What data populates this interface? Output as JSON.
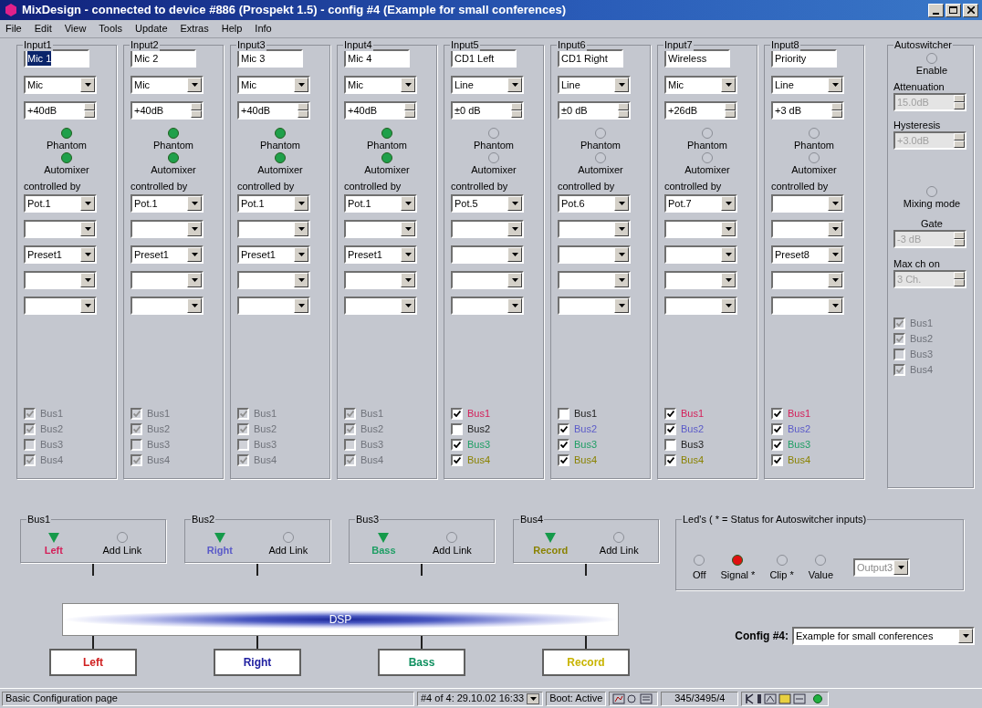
{
  "window": {
    "title": "MixDesign - connected to device #886 (Prospekt 1.5)  -  config #4 (Example for small conferences)"
  },
  "menu": [
    "File",
    "Edit",
    "View",
    "Tools",
    "Update",
    "Extras",
    "Help",
    "Info"
  ],
  "inputs": [
    {
      "title": "Input1",
      "name": "Mic 1",
      "name_selected": true,
      "type": "Mic",
      "gain": "+40dB",
      "phantom_label": "Phantom",
      "phantom": true,
      "automixer_label": "Automixer",
      "automixer": true,
      "controlled_by": "controlled by",
      "controls": [
        {
          "kind": "set",
          "value": "Pot.1"
        },
        {
          "kind": "blank"
        },
        {
          "kind": "set",
          "value": "Preset1"
        },
        {
          "kind": "blank"
        },
        {
          "kind": "blank"
        }
      ],
      "buses_disabled": true,
      "buses": [
        {
          "label": "Bus1",
          "checked": true
        },
        {
          "label": "Bus2",
          "checked": true
        },
        {
          "label": "Bus3",
          "checked": false
        },
        {
          "label": "Bus4",
          "checked": true
        }
      ]
    },
    {
      "title": "Input2",
      "name": "Mic 2",
      "name_selected": false,
      "type": "Mic",
      "gain": "+40dB",
      "phantom_label": "Phantom",
      "phantom": true,
      "automixer_label": "Automixer",
      "automixer": true,
      "controlled_by": "controlled by",
      "controls": [
        {
          "kind": "set",
          "value": "Pot.1"
        },
        {
          "kind": "blank"
        },
        {
          "kind": "set",
          "value": "Preset1"
        },
        {
          "kind": "blank"
        },
        {
          "kind": "blank"
        }
      ],
      "buses_disabled": true,
      "buses": [
        {
          "label": "Bus1",
          "checked": true
        },
        {
          "label": "Bus2",
          "checked": true
        },
        {
          "label": "Bus3",
          "checked": false
        },
        {
          "label": "Bus4",
          "checked": true
        }
      ]
    },
    {
      "title": "Input3",
      "name": "Mic 3",
      "name_selected": false,
      "type": "Mic",
      "gain": "+40dB",
      "phantom_label": "Phantom",
      "phantom": true,
      "automixer_label": "Automixer",
      "automixer": true,
      "controlled_by": "controlled by",
      "controls": [
        {
          "kind": "set",
          "value": "Pot.1"
        },
        {
          "kind": "blank"
        },
        {
          "kind": "set",
          "value": "Preset1"
        },
        {
          "kind": "blank"
        },
        {
          "kind": "blank"
        }
      ],
      "buses_disabled": true,
      "buses": [
        {
          "label": "Bus1",
          "checked": true
        },
        {
          "label": "Bus2",
          "checked": true
        },
        {
          "label": "Bus3",
          "checked": false
        },
        {
          "label": "Bus4",
          "checked": true
        }
      ]
    },
    {
      "title": "Input4",
      "name": "Mic 4",
      "name_selected": false,
      "type": "Mic",
      "gain": "+40dB",
      "phantom_label": "Phantom",
      "phantom": true,
      "automixer_label": "Automixer",
      "automixer": true,
      "controlled_by": "controlled by",
      "controls": [
        {
          "kind": "set",
          "value": "Pot.1"
        },
        {
          "kind": "blank"
        },
        {
          "kind": "set",
          "value": "Preset1"
        },
        {
          "kind": "blank"
        },
        {
          "kind": "blank"
        }
      ],
      "buses_disabled": true,
      "buses": [
        {
          "label": "Bus1",
          "checked": true
        },
        {
          "label": "Bus2",
          "checked": true
        },
        {
          "label": "Bus3",
          "checked": false
        },
        {
          "label": "Bus4",
          "checked": true
        }
      ]
    },
    {
      "title": "Input5",
      "name": "CD1 Left",
      "name_selected": false,
      "type": "Line",
      "gain": "±0 dB",
      "phantom_label": "Phantom",
      "phantom": false,
      "automixer_label": "Automixer",
      "automixer": false,
      "controlled_by": "controlled by",
      "controls": [
        {
          "kind": "set",
          "value": "Pot.5"
        },
        {
          "kind": "blank"
        },
        {
          "kind": "blank"
        },
        {
          "kind": "blank"
        },
        {
          "kind": "blank"
        }
      ],
      "buses_disabled": false,
      "buses": [
        {
          "label": "Bus1",
          "checked": true
        },
        {
          "label": "Bus2",
          "checked": false
        },
        {
          "label": "Bus3",
          "checked": true
        },
        {
          "label": "Bus4",
          "checked": true
        }
      ]
    },
    {
      "title": "Input6",
      "name": "CD1 Right",
      "name_selected": false,
      "type": "Line",
      "gain": "±0 dB",
      "phantom_label": "Phantom",
      "phantom": false,
      "automixer_label": "Automixer",
      "automixer": false,
      "controlled_by": "controlled by",
      "controls": [
        {
          "kind": "set",
          "value": "Pot.6"
        },
        {
          "kind": "blank"
        },
        {
          "kind": "blank"
        },
        {
          "kind": "blank"
        },
        {
          "kind": "blank"
        }
      ],
      "buses_disabled": false,
      "buses": [
        {
          "label": "Bus1",
          "checked": false
        },
        {
          "label": "Bus2",
          "checked": true
        },
        {
          "label": "Bus3",
          "checked": true
        },
        {
          "label": "Bus4",
          "checked": true
        }
      ]
    },
    {
      "title": "Input7",
      "name": "Wireless",
      "name_selected": false,
      "type": "Mic",
      "gain": "+26dB",
      "phantom_label": "Phantom",
      "phantom": false,
      "automixer_label": "Automixer",
      "automixer": false,
      "controlled_by": "controlled by",
      "controls": [
        {
          "kind": "set",
          "value": "Pot.7"
        },
        {
          "kind": "blank"
        },
        {
          "kind": "blank"
        },
        {
          "kind": "blank"
        },
        {
          "kind": "blank"
        }
      ],
      "buses_disabled": false,
      "buses": [
        {
          "label": "Bus1",
          "checked": true
        },
        {
          "label": "Bus2",
          "checked": true
        },
        {
          "label": "Bus3",
          "checked": false
        },
        {
          "label": "Bus4",
          "checked": true
        }
      ]
    },
    {
      "title": "Input8",
      "name": "Priority",
      "name_selected": false,
      "type": "Line",
      "gain": "+3 dB",
      "phantom_label": "Phantom",
      "phantom": false,
      "automixer_label": "Automixer",
      "automixer": false,
      "controlled_by": "controlled by",
      "controls": [
        {
          "kind": "blank"
        },
        {
          "kind": "blank"
        },
        {
          "kind": "set",
          "value": "Preset8"
        },
        {
          "kind": "blank"
        },
        {
          "kind": "blank"
        }
      ],
      "buses_disabled": false,
      "buses": [
        {
          "label": "Bus1",
          "checked": true
        },
        {
          "label": "Bus2",
          "checked": true
        },
        {
          "label": "Bus3",
          "checked": true
        },
        {
          "label": "Bus4",
          "checked": true
        }
      ]
    }
  ],
  "autoswitcher": {
    "title": "Autoswitcher",
    "enable_label": "Enable",
    "enable": false,
    "attenuation_label": "Attenuation",
    "attenuation": "15.0dB",
    "hysteresis_label": "Hysteresis",
    "hysteresis": "+3.0dB",
    "mixing_label": "Mixing mode",
    "mixing": false,
    "gate_label": "Gate",
    "gate": "-3 dB",
    "max_label": "Max ch on",
    "max": "3 Ch.",
    "buses": [
      {
        "label": "Bus1",
        "checked": true
      },
      {
        "label": "Bus2",
        "checked": true
      },
      {
        "label": "Bus3",
        "checked": false
      },
      {
        "label": "Bus4",
        "checked": true
      }
    ]
  },
  "buses": [
    {
      "title": "Bus1",
      "output": "Left",
      "color": "#d4205a",
      "link": "Add Link"
    },
    {
      "title": "Bus2",
      "output": "Right",
      "color": "#5a5ac8",
      "link": "Add Link"
    },
    {
      "title": "Bus3",
      "output": "Bass",
      "color": "#1e9e64",
      "link": "Add Link"
    },
    {
      "title": "Bus4",
      "output": "Record",
      "color": "#8a8200",
      "link": "Add Link"
    }
  ],
  "dsp": "DSP",
  "outputs": [
    {
      "label": "Left",
      "color": "#d02020"
    },
    {
      "label": "Right",
      "color": "#2020a0"
    },
    {
      "label": "Bass",
      "color": "#109060"
    },
    {
      "label": "Record",
      "color": "#c8b400"
    }
  ],
  "leds": {
    "title": "Led's ( * = Status for Autoswitcher inputs)",
    "items": [
      {
        "label": "Off",
        "selected": false
      },
      {
        "label": "Signal *",
        "selected": true
      },
      {
        "label": "Clip *",
        "selected": false
      },
      {
        "label": "Value",
        "selected": false
      }
    ],
    "output": "Output3"
  },
  "config": {
    "label": "Config #4:",
    "value": "Example for small conferences"
  },
  "status_bar": {
    "page": "Basic Configuration page",
    "config": "#4 of 4: 29.10.02 16:33",
    "boot": "Boot: Active",
    "counter": "345/3495/4"
  }
}
